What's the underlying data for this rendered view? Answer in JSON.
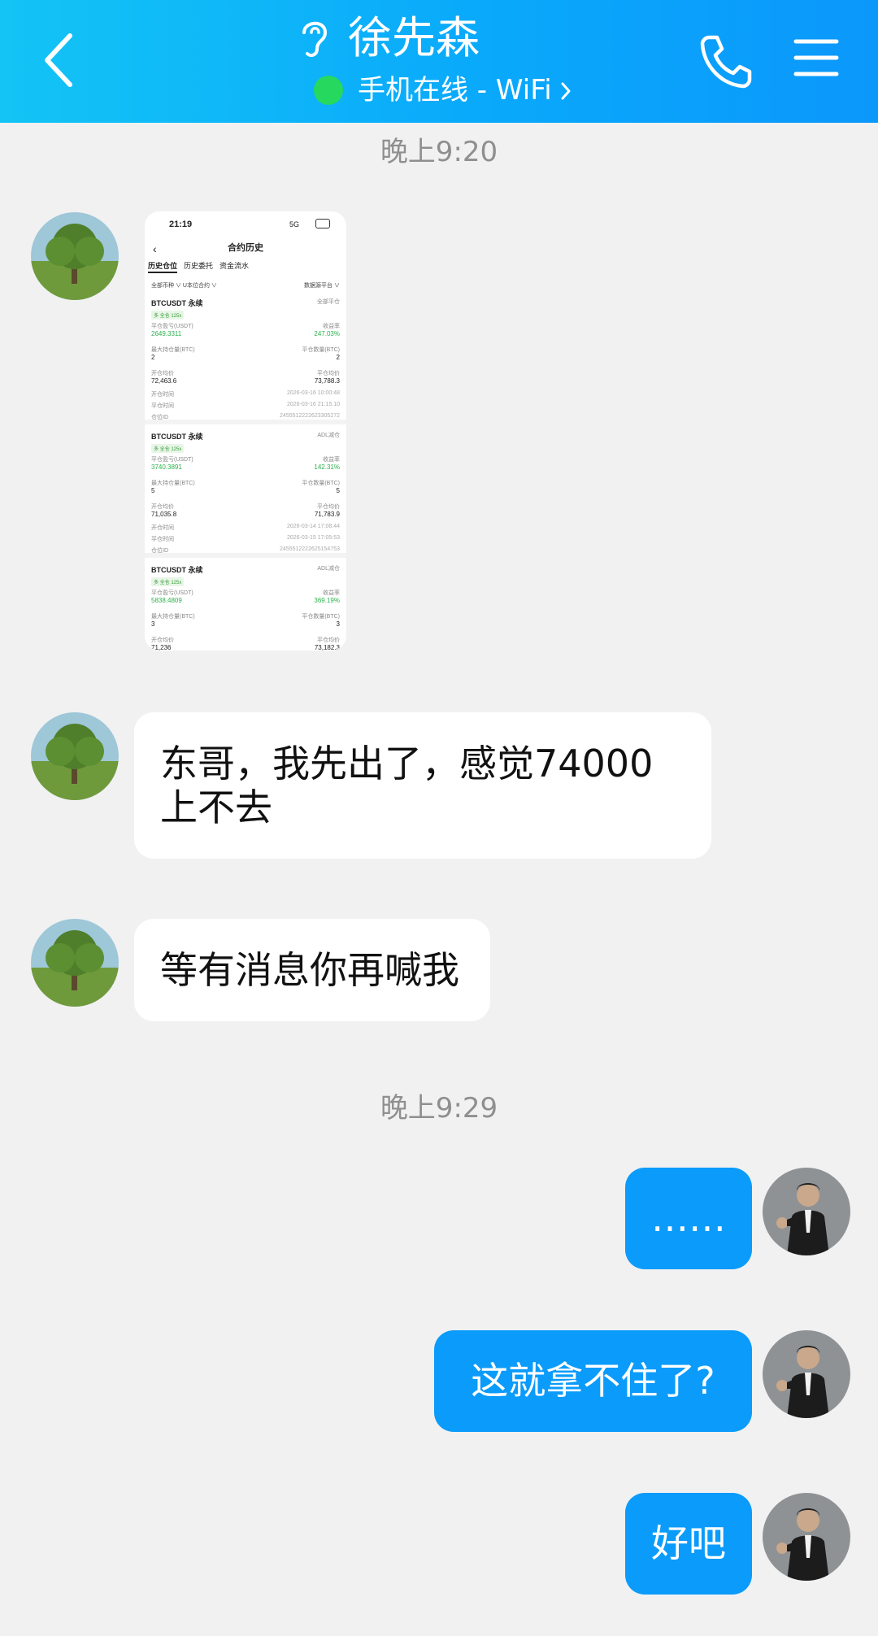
{
  "header": {
    "contact_name": "徐先森",
    "status": "手机在线 - WiFi",
    "colors": {
      "gradient_start": "#13c4f5",
      "gradient_end": "#0b98fb",
      "online": "#27d85e"
    },
    "icons": [
      "back-arrow-icon",
      "ear-icon",
      "chevron-right-icon",
      "phone-icon",
      "menu-icon"
    ]
  },
  "chat": {
    "timestamps": [
      "晚上9:20",
      "晚上9:29"
    ],
    "incoming": [
      {
        "text": "东哥，我先出了，感觉74000上不去"
      },
      {
        "text": "等有消息你再喊我"
      }
    ],
    "outgoing": [
      {
        "text": "……"
      },
      {
        "text": "这就拿不住了?"
      },
      {
        "text": "好吧"
      }
    ],
    "colors": {
      "incoming_bubble": "#ffffff",
      "outgoing_bubble": "#0b9bfb",
      "background": "#f1f1f1"
    }
  },
  "screenshot": {
    "time": "21:19",
    "signal": "5G",
    "title": "合约历史",
    "tabs": [
      "历史仓位",
      "历史委托",
      "资金流水"
    ],
    "filter_left": "全部币种 ∨   U本位合约 ∨",
    "filter_right": "数据源平台 ∨",
    "cards": [
      {
        "title": "BTCUSDT 永续",
        "tag": "全部平仓",
        "badge": "多  全仓 125x",
        "pnl_label": "平仓盈亏(USDT)",
        "pnl": "2649.3311",
        "roi_label": "收益率",
        "roi": "247.03%",
        "maxpos_label": "最大持仓量(BTC)",
        "maxpos": "2",
        "closed_label": "平仓数量(BTC)",
        "closed": "2",
        "open_label": "开仓均价",
        "open": "72,463.6",
        "close_label": "平仓均价",
        "close": "73,788.3",
        "open_time_label": "开仓时间",
        "open_time": "2026-03-16 10:00:48",
        "close_time_label": "平仓时间",
        "close_time": "2026-03-16 21:15:10",
        "id_label": "仓位ID",
        "id": "2455512222623305272"
      },
      {
        "title": "BTCUSDT 永续",
        "tag": "ADL减仓",
        "badge": "多  全仓 125x",
        "pnl_label": "平仓盈亏(USDT)",
        "pnl": "3740.3891",
        "roi_label": "收益率",
        "roi": "142.31%",
        "maxpos_label": "最大持仓量(BTC)",
        "maxpos": "5",
        "closed_label": "平仓数量(BTC)",
        "closed": "5",
        "open_label": "开仓均价",
        "open": "71,035.8",
        "close_label": "平仓均价",
        "close": "71,783.9",
        "open_time_label": "开仓时间",
        "open_time": "2026-03-14 17:08:44",
        "close_time_label": "平仓时间",
        "close_time": "2026-03-15 17:05:53",
        "id_label": "仓位ID",
        "id": "2455512222625154753"
      },
      {
        "title": "BTCUSDT 永续",
        "tag": "ADL减仓",
        "badge": "多  全仓 125x",
        "pnl_label": "平仓盈亏(USDT)",
        "pnl": "5838.4809",
        "roi_label": "收益率",
        "roi": "369.19%",
        "maxpos_label": "最大持仓量(BTC)",
        "maxpos": "3",
        "closed_label": "平仓数量(BTC)",
        "closed": "3",
        "open_label": "开仓均价",
        "open": "71,236",
        "close_label": "平仓均价",
        "close": "73,182.3"
      }
    ]
  }
}
